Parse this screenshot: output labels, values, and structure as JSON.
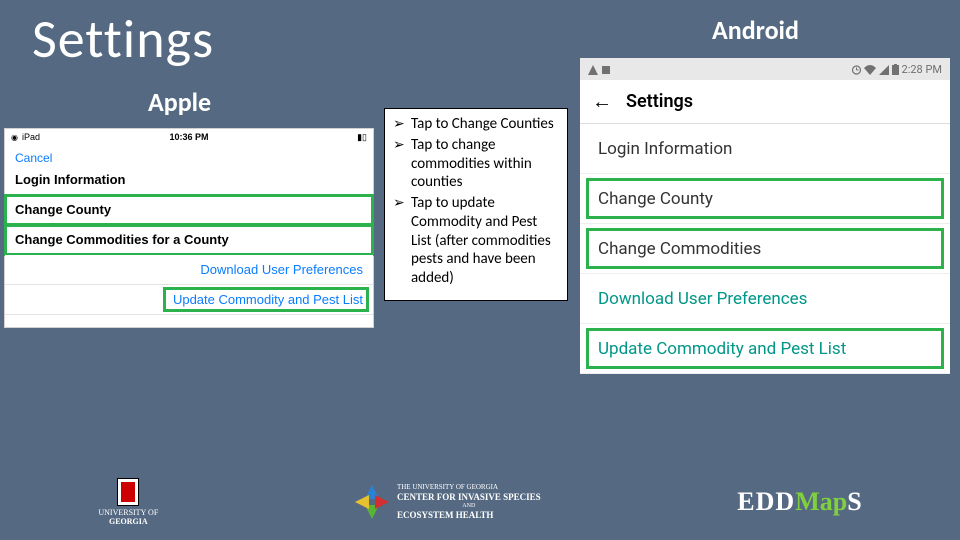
{
  "slide": {
    "title": "Settings"
  },
  "columns": {
    "apple": "Apple",
    "android": "Android"
  },
  "apple": {
    "status_left": "iPad",
    "status_time": "10:36 PM",
    "cancel": "Cancel",
    "rows": {
      "login": "Login Information",
      "change_county": "Change County",
      "change_commodities": "Change Commodities for a County",
      "download_prefs": "Download User Preferences",
      "update_list": "Update Commodity and Pest List"
    }
  },
  "instructions": {
    "item1": "Tap to Change Counties",
    "item2": "Tap to change commodities within counties",
    "item3": "Tap to update Commodity and Pest List (after commodities pests and have been added)"
  },
  "android": {
    "status_time": "2:28 PM",
    "header": "Settings",
    "rows": {
      "login": "Login Information",
      "change_county": "Change County",
      "change_commodities": "Change Commodities",
      "download_prefs": "Download User Preferences",
      "update_list": "Update Commodity and Pest List"
    }
  },
  "logos": {
    "uga_line1": "UNIVERSITY OF",
    "uga_line2": "GEORGIA",
    "center_line1": "THE UNIVERSITY OF GEORGIA",
    "center_line2": "CENTER FOR INVASIVE SPECIES",
    "center_line3": "AND",
    "center_line4": "ECOSYSTEM HEALTH",
    "edd_part1": "EDD",
    "edd_part2": "Map",
    "edd_part3": "S"
  }
}
